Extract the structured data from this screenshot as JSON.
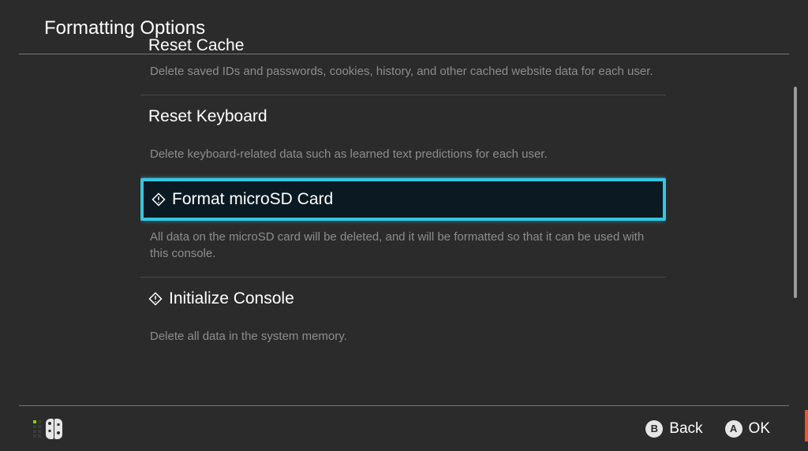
{
  "header": {
    "title": "Formatting Options"
  },
  "options": [
    {
      "key": "reset-cache",
      "title": "Reset Cache",
      "desc": "Delete saved IDs and passwords, cookies, history, and other cached website data for each user.",
      "icon": false,
      "selected": false,
      "cutoff_top": true
    },
    {
      "key": "reset-keyboard",
      "title": "Reset Keyboard",
      "desc": "Delete keyboard-related data such as learned text predictions for each user.",
      "icon": false,
      "selected": false
    },
    {
      "key": "format-microsd",
      "title": "Format microSD Card",
      "desc": "All data on the microSD card will be deleted, and it will be formatted so that it can be used with this console.",
      "icon": true,
      "selected": true
    },
    {
      "key": "initialize-console",
      "title": "Initialize Console",
      "desc": "Delete all data in the system memory.",
      "icon": true,
      "selected": false
    }
  ],
  "footer": {
    "hints": [
      {
        "button": "B",
        "label": "Back"
      },
      {
        "button": "A",
        "label": "OK"
      }
    ]
  },
  "colors": {
    "highlight": "#35c6e0",
    "background": "#2b2b2b",
    "accent": "#ff4d2e"
  }
}
